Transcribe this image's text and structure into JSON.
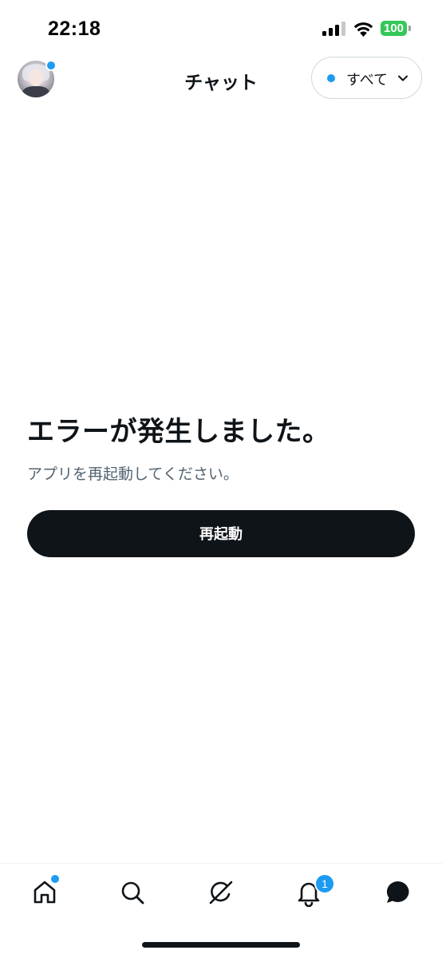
{
  "status_bar": {
    "time": "22:18",
    "battery": "100",
    "icons": [
      "cellular-signal-icon",
      "wifi-icon",
      "battery-icon"
    ]
  },
  "header": {
    "title": "チャット",
    "filter_label": "すべて",
    "avatar_has_notification": true
  },
  "error": {
    "title": "エラーが発生しました。",
    "subtitle": "アプリを再起動してください。",
    "restart_label": "再起動"
  },
  "tab_bar": {
    "items": [
      {
        "name": "home",
        "icon": "home-icon",
        "has_dot": true
      },
      {
        "name": "search",
        "icon": "search-icon"
      },
      {
        "name": "grok",
        "icon": "grok-icon"
      },
      {
        "name": "notifications",
        "icon": "bell-icon",
        "badge": "1"
      },
      {
        "name": "chat",
        "icon": "chat-bubble-icon",
        "active": true
      }
    ]
  },
  "colors": {
    "accent": "#1d9bf0",
    "text_primary": "#0f1419",
    "text_secondary": "#536471",
    "button_bg": "#0f1419",
    "battery_green": "#34c759",
    "border": "#cfd9de"
  }
}
